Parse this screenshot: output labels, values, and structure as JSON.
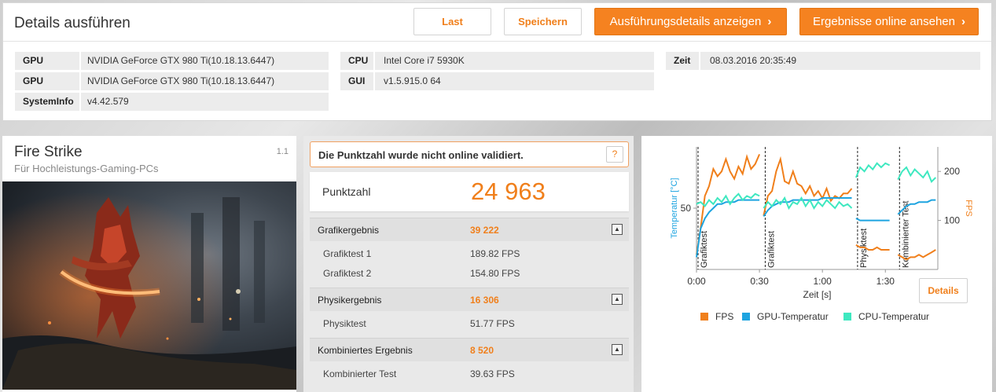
{
  "header": {
    "title": "Details ausführen",
    "buttons": {
      "load": "Last",
      "save": "Speichern",
      "run_details": "Ausführungsdetails anzeigen",
      "online_results": "Ergebnisse online ansehen"
    },
    "chevron": "›"
  },
  "system_info": [
    {
      "key": "GPU",
      "value": "NVIDIA GeForce GTX 980 Ti(10.18.13.6447)"
    },
    {
      "key": "GPU",
      "value": "NVIDIA GeForce GTX 980 Ti(10.18.13.6447)"
    },
    {
      "key": "SystemInfo",
      "value": "v4.42.579"
    },
    {
      "key": "CPU",
      "value": "Intel Core i7 5930K"
    },
    {
      "key": "GUI",
      "value": "v1.5.915.0 64"
    },
    {
      "key": "Zeit",
      "value": "08.03.2016 20:35:49"
    }
  ],
  "test": {
    "name": "Fire Strike",
    "subtitle": "Für Hochleistungs-Gaming-PCs",
    "version": "1.1"
  },
  "notice": {
    "text": "Die Punktzahl wurde nicht online validiert.",
    "help": "?"
  },
  "score": {
    "label": "Punktzahl",
    "value": "24 963"
  },
  "results": {
    "graphics": {
      "label": "Grafikergebnis",
      "value": "39 222",
      "rows": [
        {
          "label": "Grafiktest 1",
          "value": "189.82 FPS"
        },
        {
          "label": "Grafiktest 2",
          "value": "154.80 FPS"
        }
      ]
    },
    "physics": {
      "label": "Physikergebnis",
      "value": "16 306",
      "rows": [
        {
          "label": "Physiktest",
          "value": "51.77 FPS"
        }
      ]
    },
    "combined": {
      "label": "Kombiniertes Ergebnis",
      "value": "8 520",
      "rows": [
        {
          "label": "Kombinierter Test",
          "value": "39.63 FPS"
        }
      ]
    },
    "toggle_icon": "▲"
  },
  "details_button": "Details",
  "colors": {
    "accent": "#f07f1b",
    "fps": "#f07f1b",
    "gpu_temp": "#1ea4e0",
    "cpu_temp": "#3ee8c0"
  },
  "chart_data": {
    "type": "line",
    "xlabel": "Zeit [s]",
    "ylabel_left": "Temperatur [°C]",
    "ylabel_right": "FPS",
    "x_ticks": [
      "0:00",
      "0:30",
      "1:00",
      "1:30"
    ],
    "x_tick_values": [
      0,
      30,
      60,
      90
    ],
    "xlim": [
      0,
      115
    ],
    "y_left_ticks": [
      50
    ],
    "y_left_range": [
      20,
      80
    ],
    "y_right_ticks": [
      100,
      200
    ],
    "y_right_range": [
      0,
      250
    ],
    "section_labels": [
      {
        "label": "Grafiktest",
        "start": 0
      },
      {
        "label": "Grafiktest",
        "start": 32
      },
      {
        "label": "Physiktest",
        "start": 76
      },
      {
        "label": "Kombinierter Test",
        "start": 96
      }
    ],
    "legend": [
      "FPS",
      "GPU-Temperatur",
      "CPU-Temperatur"
    ],
    "series": [
      {
        "name": "FPS",
        "axis": "right",
        "segments": [
          [
            [
              0,
              30
            ],
            [
              2,
              85
            ],
            [
              4,
              150
            ],
            [
              6,
              170
            ],
            [
              8,
              205
            ],
            [
              10,
              190
            ],
            [
              12,
              200
            ],
            [
              14,
              225
            ],
            [
              16,
              200
            ],
            [
              18,
              185
            ],
            [
              20,
              210
            ],
            [
              22,
              195
            ],
            [
              24,
              230
            ],
            [
              26,
              205
            ],
            [
              28,
              215
            ],
            [
              30,
              235
            ]
          ],
          [
            [
              32,
              110
            ],
            [
              34,
              150
            ],
            [
              36,
              160
            ],
            [
              38,
              200
            ],
            [
              40,
              225
            ],
            [
              42,
              180
            ],
            [
              44,
              175
            ],
            [
              46,
              200
            ],
            [
              48,
              175
            ],
            [
              50,
              170
            ],
            [
              52,
              155
            ],
            [
              54,
              170
            ],
            [
              56,
              150
            ],
            [
              58,
              160
            ],
            [
              60,
              145
            ],
            [
              62,
              165
            ],
            [
              64,
              140
            ],
            [
              66,
              150
            ],
            [
              68,
              145
            ],
            [
              70,
              155
            ],
            [
              72,
              155
            ],
            [
              74,
              165
            ]
          ],
          [
            [
              76,
              50
            ],
            [
              78,
              45
            ],
            [
              80,
              45
            ],
            [
              82,
              40
            ],
            [
              84,
              40
            ],
            [
              86,
              45
            ],
            [
              88,
              40
            ],
            [
              90,
              40
            ],
            [
              92,
              40
            ]
          ],
          [
            [
              96,
              30
            ],
            [
              98,
              25
            ],
            [
              100,
              20
            ],
            [
              102,
              25
            ],
            [
              104,
              25
            ],
            [
              106,
              30
            ],
            [
              108,
              25
            ],
            [
              110,
              30
            ],
            [
              112,
              35
            ],
            [
              114,
              40
            ]
          ]
        ]
      },
      {
        "name": "GPU-Temperatur",
        "axis": "left",
        "segments": [
          [
            [
              0,
              26
            ],
            [
              2,
              40
            ],
            [
              4,
              45
            ],
            [
              6,
              48
            ],
            [
              8,
              50
            ],
            [
              10,
              52
            ],
            [
              12,
              52
            ],
            [
              14,
              53
            ],
            [
              16,
              53
            ],
            [
              18,
              53
            ],
            [
              20,
              54
            ],
            [
              22,
              54
            ],
            [
              24,
              54
            ],
            [
              26,
              54
            ],
            [
              28,
              54
            ],
            [
              30,
              54
            ]
          ],
          [
            [
              32,
              46
            ],
            [
              34,
              49
            ],
            [
              36,
              51
            ],
            [
              38,
              52
            ],
            [
              40,
              53
            ],
            [
              42,
              53
            ],
            [
              44,
              53
            ],
            [
              46,
              54
            ],
            [
              48,
              54
            ],
            [
              50,
              54
            ],
            [
              52,
              54
            ],
            [
              54,
              54
            ],
            [
              56,
              54
            ],
            [
              58,
              54
            ],
            [
              60,
              55
            ],
            [
              62,
              55
            ],
            [
              64,
              55
            ],
            [
              66,
              55
            ],
            [
              68,
              55
            ],
            [
              70,
              55
            ],
            [
              72,
              55
            ],
            [
              74,
              55
            ]
          ],
          [
            [
              76,
              45
            ],
            [
              78,
              44
            ],
            [
              80,
              44
            ],
            [
              82,
              44
            ],
            [
              84,
              44
            ],
            [
              86,
              44
            ],
            [
              88,
              44
            ],
            [
              90,
              44
            ],
            [
              92,
              44
            ]
          ],
          [
            [
              96,
              47
            ],
            [
              98,
              49
            ],
            [
              100,
              51
            ],
            [
              102,
              52
            ],
            [
              104,
              52
            ],
            [
              106,
              53
            ],
            [
              108,
              53
            ],
            [
              110,
              53
            ],
            [
              112,
              54
            ],
            [
              114,
              54
            ]
          ]
        ]
      },
      {
        "name": "CPU-Temperatur",
        "axis": "left",
        "segments": [
          [
            [
              0,
              52
            ],
            [
              2,
              53
            ],
            [
              4,
              51
            ],
            [
              6,
              54
            ],
            [
              8,
              52
            ],
            [
              10,
              55
            ],
            [
              12,
              53
            ],
            [
              14,
              56
            ],
            [
              16,
              52
            ],
            [
              18,
              55
            ],
            [
              20,
              57
            ],
            [
              22,
              54
            ],
            [
              24,
              56
            ],
            [
              26,
              55
            ],
            [
              28,
              57
            ],
            [
              30,
              56
            ]
          ],
          [
            [
              32,
              50
            ],
            [
              34,
              53
            ],
            [
              36,
              51
            ],
            [
              38,
              54
            ],
            [
              40,
              52
            ],
            [
              42,
              55
            ],
            [
              44,
              50
            ],
            [
              46,
              53
            ],
            [
              48,
              52
            ],
            [
              50,
              55
            ],
            [
              52,
              51
            ],
            [
              54,
              54
            ],
            [
              56,
              50
            ],
            [
              58,
              53
            ],
            [
              60,
              51
            ],
            [
              62,
              54
            ],
            [
              64,
              52
            ],
            [
              66,
              50
            ],
            [
              68,
              53
            ],
            [
              70,
              51
            ],
            [
              72,
              52
            ],
            [
              74,
              50
            ]
          ],
          [
            [
              76,
              65
            ],
            [
              78,
              70
            ],
            [
              80,
              68
            ],
            [
              82,
              71
            ],
            [
              84,
              69
            ],
            [
              86,
              72
            ],
            [
              88,
              70
            ],
            [
              90,
              72
            ],
            [
              92,
              71
            ]
          ],
          [
            [
              96,
              64
            ],
            [
              98,
              68
            ],
            [
              100,
              70
            ],
            [
              102,
              66
            ],
            [
              104,
              69
            ],
            [
              106,
              67
            ],
            [
              108,
              65
            ],
            [
              110,
              68
            ],
            [
              112,
              63
            ],
            [
              114,
              65
            ]
          ]
        ]
      }
    ]
  }
}
